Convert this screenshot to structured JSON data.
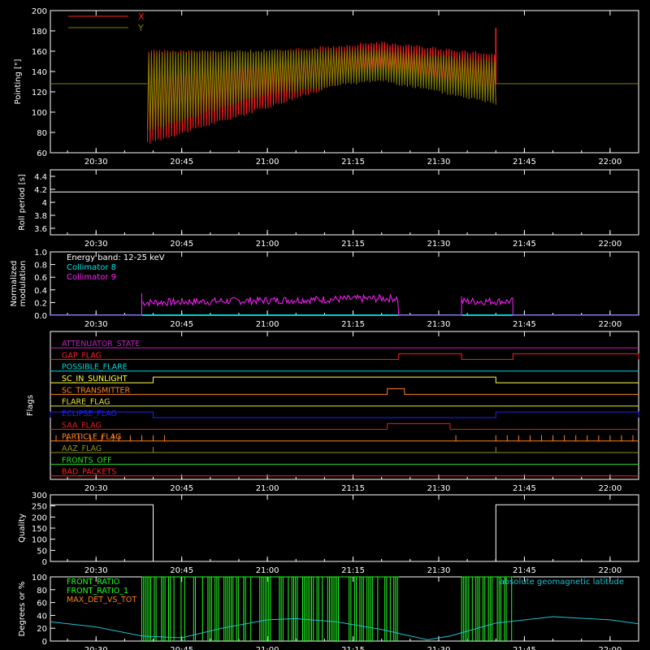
{
  "time_axis": {
    "ticks": [
      "20:30",
      "20:45",
      "21:00",
      "21:15",
      "21:30",
      "21:45",
      "22:00"
    ],
    "range": [
      "20:22",
      "22:05"
    ]
  },
  "colors": {
    "background": "#000000",
    "axes": "#ffffff",
    "x": "#ff2020",
    "y": "#808000",
    "roll": "#ffffff",
    "collimator8": "#00e5e5",
    "collimator9": "#ff20ff",
    "quality": "#ffffff",
    "front_ratio": "#20ff20",
    "front_ratio_2": "#20ff20",
    "max_det": "#ff8020",
    "geolat": "#20c0d0"
  },
  "chart_data": [
    {
      "id": "pointing",
      "type": "line",
      "ylabel": "Pointing [\"]",
      "ylim": [
        60,
        200
      ],
      "yticks": [
        60,
        80,
        100,
        120,
        140,
        160,
        180,
        200
      ],
      "legend": [
        "X",
        "Y"
      ],
      "legend_placement": "top-left",
      "series": [
        {
          "name": "X",
          "constant": 128,
          "active": [
            "20:39",
            "21:40"
          ],
          "env_start": [
            68,
            162
          ],
          "env_min": [
            102,
            160
          ],
          "env_peak": [
            140,
            170
          ],
          "env_end": [
            110,
            158
          ],
          "spike_end": 183
        },
        {
          "name": "Y",
          "constant": 128,
          "active": [
            "20:39",
            "21:40"
          ],
          "env_start": [
            80,
            160
          ],
          "env_min": [
            115,
            162
          ],
          "env_peak": [
            130,
            163
          ],
          "env_end": [
            107,
            152
          ]
        }
      ]
    },
    {
      "id": "roll",
      "type": "line",
      "ylabel": "Roll period [s]",
      "ylim": [
        3.5,
        4.5
      ],
      "yticks": [
        3.6,
        3.8,
        4.0,
        4.2,
        4.4
      ],
      "value": 4.16
    },
    {
      "id": "modulation",
      "type": "line",
      "ylabel": [
        "Normalized",
        "modulation"
      ],
      "ylim": [
        0,
        1
      ],
      "yticks": [
        "0.0",
        "0.2",
        "0.4",
        "0.6",
        "0.8",
        "1.0"
      ],
      "annotations": [
        "Energy band: 12-25 keV",
        "Collimator 8",
        "Collimator 9"
      ],
      "series": [
        {
          "name": "Collimator 8",
          "value": 0.0
        },
        {
          "name": "Collimator 9",
          "segments": [
            [
              "20:38",
              "21:23",
              0.2,
              0.27
            ],
            [
              "21:34",
              "21:43",
              0.22,
              0.22
            ]
          ]
        }
      ]
    },
    {
      "id": "flags",
      "type": "line",
      "ylabel": "Flags",
      "series": [
        {
          "name": "ATTENUATOR_STATE",
          "color": "#c020c0",
          "steps": []
        },
        {
          "name": "GAP_FLAG",
          "color": "#ff2020",
          "steps": [
            [
              "21:23",
              "21:34"
            ],
            [
              "21:43",
              "22:05"
            ]
          ]
        },
        {
          "name": "POSSIBLE_FLARE",
          "color": "#00d8d8",
          "steps": []
        },
        {
          "name": "SC_IN_SUNLIGHT",
          "color": "#ffff40",
          "steps": [
            [
              "20:40",
              "21:40"
            ]
          ]
        },
        {
          "name": "SC_TRANSMITTER",
          "color": "#ff8020",
          "steps": [
            [
              "21:21",
              "21:24"
            ]
          ]
        },
        {
          "name": "FLARE_FLAG",
          "color": "#e0e040",
          "steps": []
        },
        {
          "name": "ECLIPSE_FLAG",
          "color": "#2020ff",
          "steps": [
            [
              "20:22",
              "20:40"
            ],
            [
              "21:40",
              "22:05"
            ]
          ]
        },
        {
          "name": "SAA_FLAG",
          "color": "#e02020",
          "steps": [
            [
              "21:21",
              "21:32"
            ]
          ]
        },
        {
          "name": "PARTICLE_FLAG",
          "color": "#ff8020",
          "steps": [],
          "pulses": [
            "20:23",
            "20:25",
            "20:27",
            "20:29",
            "20:31",
            "20:33",
            "20:34",
            "20:36",
            "20:38",
            "20:40",
            "20:42",
            "21:33",
            "21:40",
            "21:42",
            "21:44",
            "21:46",
            "21:48",
            "21:50",
            "21:52",
            "21:54",
            "21:56",
            "21:58",
            "22:00",
            "22:02",
            "22:04"
          ]
        },
        {
          "name": "AAZ_FLAG",
          "color": "#909020",
          "steps": [],
          "pulses": [
            "20:40",
            "21:40"
          ]
        },
        {
          "name": "FRONTS_OFF",
          "color": "#20e020",
          "steps": []
        },
        {
          "name": "BAD_PACKETS",
          "color": "#ff2020",
          "steps": []
        }
      ]
    },
    {
      "id": "quality",
      "type": "line",
      "ylabel": "Quality",
      "ylim": [
        0,
        300
      ],
      "yticks": [
        0,
        50,
        100,
        150,
        200,
        250,
        300
      ],
      "segments": [
        [
          "20:22",
          "20:40",
          255
        ],
        [
          "20:40",
          "21:40",
          0
        ],
        [
          "21:40",
          "22:05",
          255
        ]
      ]
    },
    {
      "id": "ratios",
      "type": "line",
      "ylabel": "Degrees or %",
      "ylim": [
        0,
        100
      ],
      "yticks": [
        0,
        20,
        40,
        60,
        80,
        100
      ],
      "legend": [
        "FRONT_RATIO",
        "FRONT_RATIO_1",
        "MAX_DET_VS_TOT"
      ],
      "annotation": "absolute geomagnetic latitude",
      "series": [
        {
          "name": "FRONT_RATIO",
          "active": [
            [
              "20:38",
              "21:23"
            ],
            [
              "21:34",
              "21:43"
            ]
          ]
        },
        {
          "name": "absolute geomagnetic latitude",
          "points": [
            [
              "20:22",
              30
            ],
            [
              "20:30",
              22
            ],
            [
              "20:38",
              8
            ],
            [
              "20:45",
              5
            ],
            [
              "20:52",
              20
            ],
            [
              "21:00",
              33
            ],
            [
              "21:05",
              35
            ],
            [
              "21:12",
              30
            ],
            [
              "21:20",
              18
            ],
            [
              "21:25",
              8
            ],
            [
              "21:28",
              2
            ],
            [
              "21:32",
              8
            ],
            [
              "21:40",
              28
            ],
            [
              "21:50",
              38
            ],
            [
              "22:00",
              33
            ],
            [
              "22:05",
              27
            ]
          ]
        }
      ]
    }
  ]
}
